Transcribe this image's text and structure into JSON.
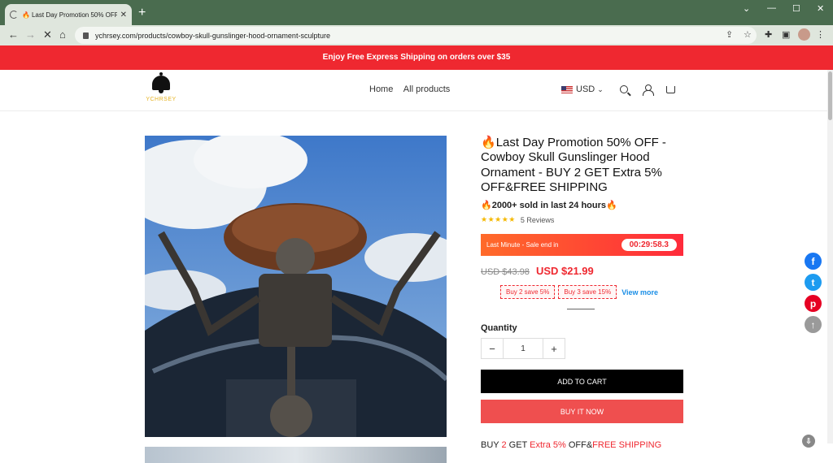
{
  "browser": {
    "tab_title": "Last Day Promotion 50% OFF",
    "new_tab": "+",
    "url": "ychrsey.com/products/cowboy-skull-gunslinger-hood-ornament-sculpture",
    "window_minimize": "⌄",
    "window_min": "—",
    "window_max": "☐",
    "window_close": "✕"
  },
  "banner": {
    "text": "Enjoy Free Express Shipping on orders over $35"
  },
  "header": {
    "logo_text": "YCHRSEY",
    "nav": [
      "Home",
      "All products"
    ],
    "currency": "USD"
  },
  "product": {
    "title": "Last Day Promotion 50% OFF - Cowboy Skull Gunslinger Hood Ornament - BUY 2 GET Extra 5% OFF&FREE SHIPPING",
    "sold": "2000+ sold in last 24 hours",
    "stars": "★★★★★",
    "reviews": "5 Reviews",
    "countdown_label": "Last Minute - Sale end in",
    "countdown": "00:29:58.3",
    "old_price": "USD $43.98",
    "new_price": "USD $21.99",
    "coupons": [
      "Buy 2 save 5%",
      "Buy 3 save 15%"
    ],
    "view_more": "View more",
    "quantity_label": "Quantity",
    "quantity": "1",
    "minus": "−",
    "plus": "+",
    "add_to_cart": "ADD TO CART",
    "buy_now": "BUY IT NOW",
    "promo": {
      "a": "BUY ",
      "b": "2",
      "c": " GET ",
      "d": "Extra 5%",
      "e": " OFF&",
      "f": "FREE SHIPPING"
    }
  },
  "social": {
    "facebook": "f",
    "twitter": "t",
    "pinterest": "p",
    "top": "↑"
  },
  "colors": {
    "banner": "#ef2830",
    "accent": "#ef2830",
    "link": "#1a8ee6",
    "buy_now": "#ef4f4f"
  }
}
